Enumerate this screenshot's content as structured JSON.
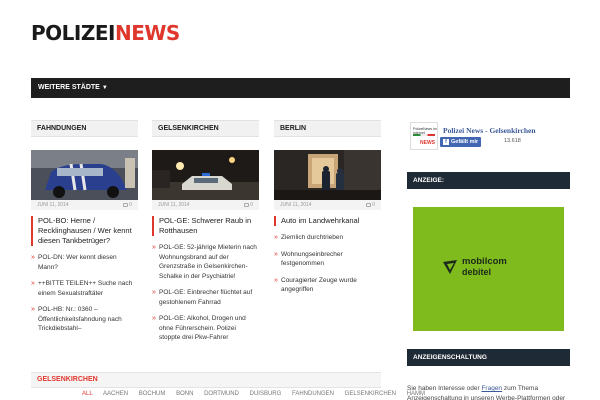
{
  "logo": {
    "part1": "POLIZEI",
    "part2": "NEWS"
  },
  "nav": {
    "item1": "WEITERE STÄDTE"
  },
  "columns": [
    {
      "header": "FAHNDUNGEN",
      "date": "JUNI 11, 2014",
      "comments": "0",
      "lead": "POL-BO: Herne / Recklinghausen / Wer kennt diesen Tankbetrüger?",
      "items": [
        "POL-DN: Wer kennt diesen Mann?",
        "++BITTE TEILEN++ Suche nach einem Sexualstraftäter",
        "POL-HB: Nr.: 0360 – Öffentlichkeitsfahndung nach Trickdiebstahl–"
      ]
    },
    {
      "header": "GELSENKIRCHEN",
      "date": "JUNI 11, 2014",
      "comments": "0",
      "lead": "POL-GE: Schwerer Raub in Rotthausen",
      "items": [
        "POL-GE: 52-jährige Mieterin nach Wohnungsbrand auf der Grenzstraße in Gelsenkirchen-Schalke in der Psychiatrie!",
        "POL-GE: Einbrecher flüchtet auf gestohlenem Fahrrad",
        "POL-GE: Alkohol, Drogen und ohne Führerschein. Polizei stoppte drei Pkw-Fahrer"
      ]
    },
    {
      "header": "BERLIN",
      "date": "JUNI 11, 2014",
      "comments": "0",
      "lead": "Auto im Landwehrkanal",
      "items": [
        "Ziemlich durchtrieben",
        "Wohnungseinbrecher festgenommen",
        "Couragierter Zeuge wurde angegriffen"
      ]
    }
  ],
  "facebook": {
    "logo_line": "PolizeiNews im Internet",
    "logo_brand": "NEWS",
    "title": "Polizei News - Gelsenkirchen",
    "like_label": "Gefällt mir",
    "count": "13.618"
  },
  "widgets": {
    "ad_head": "ANZEIGE:",
    "ads_head": "ANZEIGENSCHALTUNG"
  },
  "ad": {
    "line1": "mobilcom",
    "line2": "debitel",
    "color": "#7fbb1c"
  },
  "sidebar_text": {
    "before": "Sie haben Interesse oder ",
    "link": "Fragen",
    "after": " zum Thema Anzeigenschaltung in unseren Werbe-Plattformen oder"
  },
  "bottom": {
    "section": "GELSENKIRCHEN",
    "filters": [
      "ALL",
      "AACHEN",
      "BOCHUM",
      "BONN",
      "DORTMUND",
      "DUISBURG",
      "FAHNDUNGEN",
      "GELSENKIRCHEN",
      "HAMM"
    ]
  },
  "colors": {
    "accent": "#e0372d",
    "nav": "#1e1e1e",
    "widget": "#1e2a35",
    "facebook": "#4267b2"
  }
}
